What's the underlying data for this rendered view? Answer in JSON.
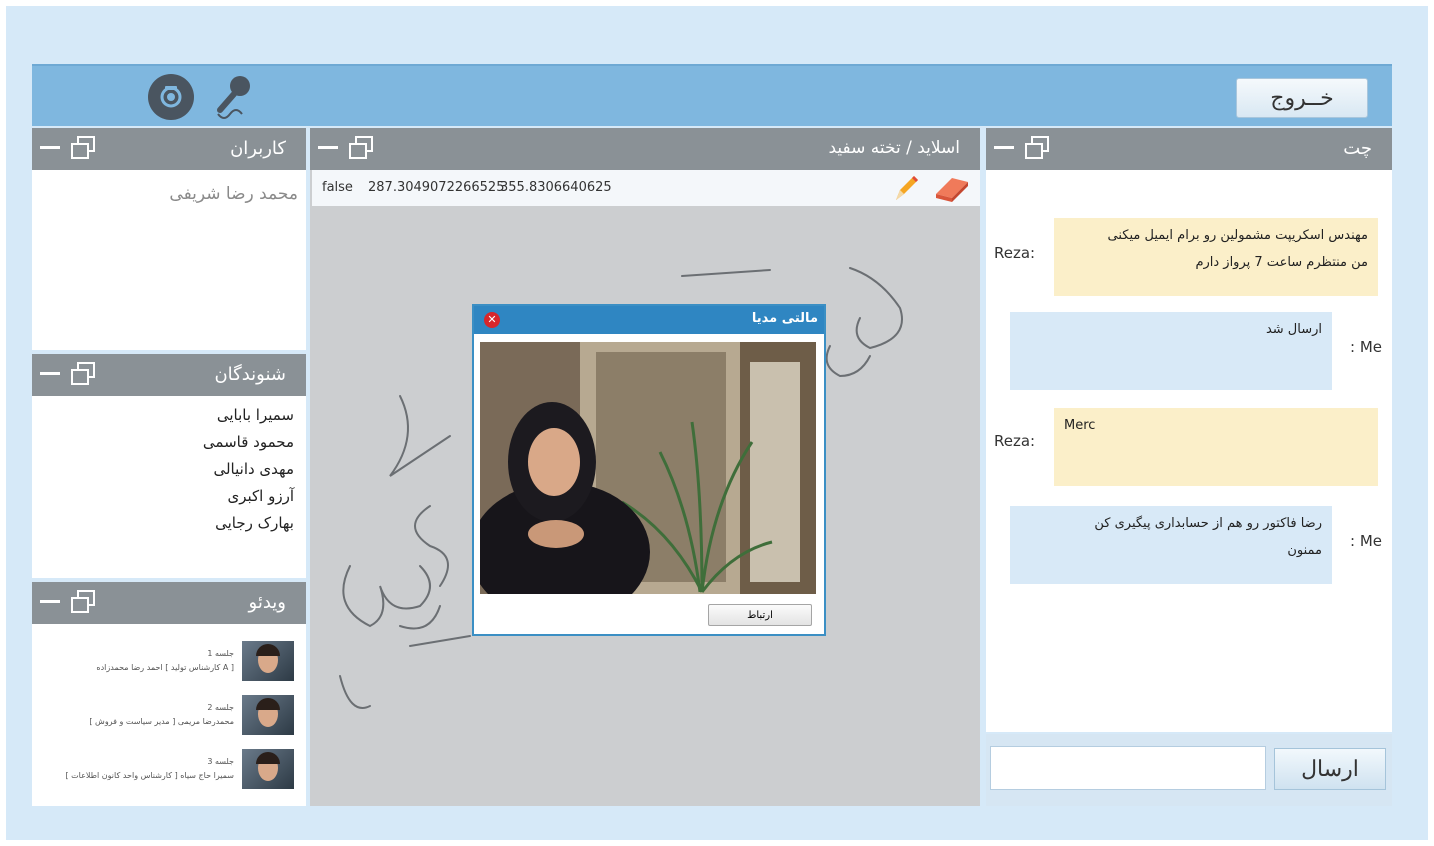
{
  "topbar": {
    "exit_label": "خــروج"
  },
  "users_panel": {
    "title": "کاربران",
    "user": "محمد رضا شریفی"
  },
  "listeners_panel": {
    "title": "شنوندگان",
    "items": [
      "سمیرا بابایی",
      "محمود قاسمی",
      "مهدی دانیالی",
      "آرزو اکبری",
      "بهارک رجایی"
    ]
  },
  "video_panel": {
    "title": "ویدئو",
    "items": [
      {
        "line1": "جلسه 1",
        "line2": "احمد رضا محمدزاده [ کارشناس تولید A ]"
      },
      {
        "line1": "جلسه 2",
        "line2": "محمدرضا مریمی [ مدیر سیاست و فروش ]"
      },
      {
        "line1": "جلسه 3",
        "line2": "سمیرا حاج سیاه [ کارشناس واحد کانون اطلاعات ]"
      }
    ]
  },
  "board_panel": {
    "title": "اسلاید / تخته سفید",
    "toolbar": {
      "flag": "false",
      "x": "287.3049072266525",
      "y": "355.8306640625"
    }
  },
  "dialog": {
    "title": "مالتی مدیا",
    "button_label": "ارتباط"
  },
  "chat_panel": {
    "title": "چت",
    "messages": [
      {
        "sender": "Reza:",
        "text_line1": "مهندس اسکریپت مشمولین رو برام ایمیل میکنی",
        "text_line2": "من منتظرم ساعت 7 پرواز دارم"
      },
      {
        "sender": ": Me",
        "text_line1": "ارسال شد",
        "text_line2": ""
      },
      {
        "sender": "Reza:",
        "text_line1": "Merc",
        "text_line2": ""
      },
      {
        "sender": ": Me",
        "text_line1": "رضا فاکتور رو هم از حسابداری پیگیری کن",
        "text_line2": "ممنون"
      }
    ],
    "input_placeholder": "",
    "send_label": "ارسال"
  }
}
